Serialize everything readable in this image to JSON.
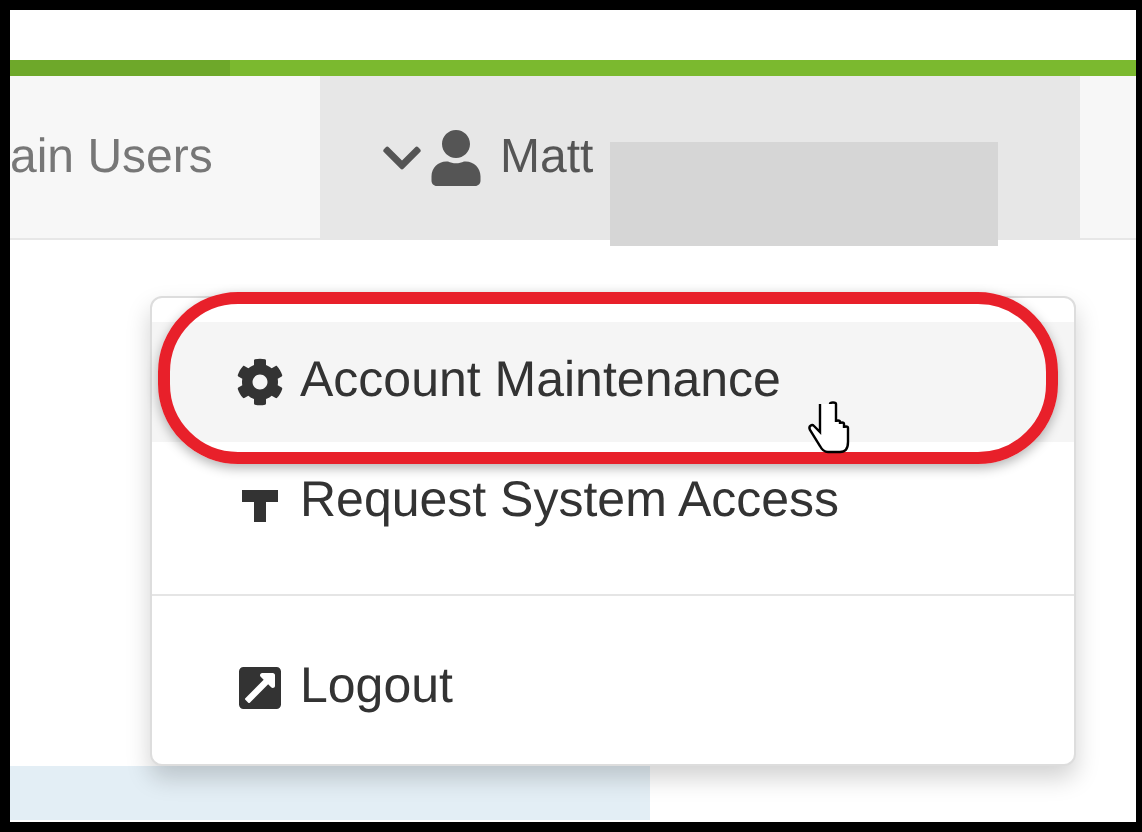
{
  "navbar": {
    "link": "ain Users",
    "user": {
      "name": "Matt",
      "expanded": true
    }
  },
  "menu": {
    "items": [
      {
        "kind": "item",
        "label": "Account Maintenance",
        "selected": true
      },
      {
        "kind": "item",
        "label": "Request System Access",
        "selected": false
      },
      {
        "kind": "divider"
      },
      {
        "kind": "item",
        "label": "Logout",
        "selected": false
      }
    ]
  }
}
